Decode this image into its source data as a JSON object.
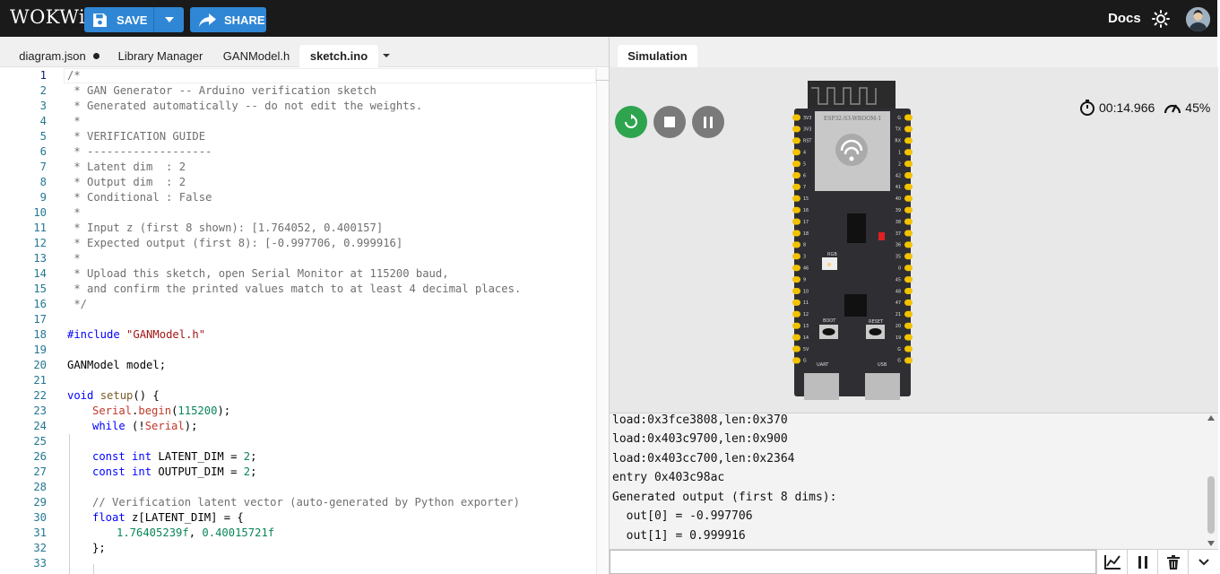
{
  "header": {
    "logo": "WOKWi",
    "save_label": "SAVE",
    "share_label": "SHARE",
    "docs_label": "Docs"
  },
  "editor": {
    "tabs": [
      {
        "label": "diagram.json",
        "modified": true
      },
      {
        "label": "Library Manager"
      },
      {
        "label": "GANModel.h"
      },
      {
        "label": "sketch.ino",
        "active": true
      }
    ],
    "line_numbers": [
      "1",
      "2",
      "3",
      "4",
      "5",
      "6",
      "7",
      "8",
      "9",
      "10",
      "11",
      "12",
      "13",
      "14",
      "15",
      "16",
      "17",
      "18",
      "19",
      "20",
      "21",
      "22",
      "23",
      "24",
      "25",
      "26",
      "27",
      "28",
      "29",
      "30",
      "31",
      "32",
      "33"
    ],
    "code": {
      "l1": "/*",
      "l2": " * GAN Generator -- Arduino verification sketch",
      "l3": " * Generated automatically -- do not edit the weights.",
      "l4": " *",
      "l5": " * VERIFICATION GUIDE",
      "l6": " * -------------------",
      "l7": " * Latent dim  : 2",
      "l8": " * Output dim  : 2",
      "l9": " * Conditional : False",
      "l10": " *",
      "l11": " * Input z (first 8 shown): [1.764052, 0.400157]",
      "l12": " * Expected output (first 8): [-0.997706, 0.999916]",
      "l13": " *",
      "l14": " * Upload this sketch, open Serial Monitor at 115200 baud,",
      "l15": " * and confirm the printed values match to at least 4 decimal places.",
      "l16": " */",
      "l18_kw": "#include",
      "l18_str": "\"GANModel.h\"",
      "l20": "GANModel model;",
      "l22_kw": "void",
      "l22_fn": "setup",
      "l22_rest": "() {",
      "l23_obj": "Serial",
      "l23_dot": ".",
      "l23_fn": "begin",
      "l23_p1": "(",
      "l23_num": "115200",
      "l23_p2": ");",
      "l24_kw": "while",
      "l24_p1": " (!",
      "l24_obj": "Serial",
      "l24_p2": ");",
      "l26_kw1": "const",
      "l26_kw2": "int",
      "l26_rest": " LATENT_DIM = ",
      "l26_num": "2",
      "l26_end": ";",
      "l27_kw1": "const",
      "l27_kw2": "int",
      "l27_rest": " OUTPUT_DIM = ",
      "l27_num": "2",
      "l27_end": ";",
      "l29": "// Verification latent vector (auto-generated by Python exporter)",
      "l30_kw": "float",
      "l30_rest": " z[LATENT_DIM] = {",
      "l31_n1": "1.76405239f",
      "l31_sep": ", ",
      "l31_n2": "0.40015721f",
      "l32": "};"
    }
  },
  "simulation": {
    "tab_label": "Simulation",
    "timer": "00:14.966",
    "speed": "45%",
    "board": {
      "module_label": "ESP32-S3-WROOM-1",
      "rgb_label": "RGB",
      "boot_label": "BOOT",
      "reset_label": "RESET",
      "uart_label": "UART",
      "usb_label": "USB",
      "left_pins": [
        "3V3",
        "3V3",
        "RST",
        "4",
        "5",
        "6",
        "7",
        "15",
        "16",
        "17",
        "18",
        "8",
        "3",
        "46",
        "9",
        "10",
        "11",
        "12",
        "13",
        "14",
        "5V",
        "G"
      ],
      "right_pins": [
        "G",
        "TX",
        "RX",
        "1",
        "2",
        "42",
        "41",
        "40",
        "39",
        "38",
        "37",
        "36",
        "35",
        "0",
        "45",
        "48",
        "47",
        "21",
        "20",
        "19",
        "G",
        "G"
      ]
    }
  },
  "serial": {
    "lines": [
      "load:0x3fce3808,len:0x370",
      "load:0x403c9700,len:0x900",
      "load:0x403cc700,len:0x2364",
      "entry 0x403c98ac",
      "Generated output (first 8 dims):",
      "  out[0] = -0.997706",
      "  out[1] = 0.999916"
    ],
    "input_value": ""
  },
  "colors": {
    "topbar": "#1a1a1a",
    "button_blue": "#2f86d4",
    "restart_green": "#2ea44f",
    "ctrl_gray": "#7a7a7a"
  }
}
